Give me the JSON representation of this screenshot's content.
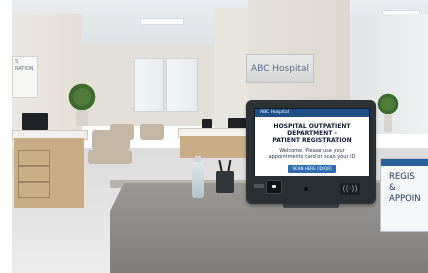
{
  "wall_sign": {
    "text": "ABC Hospital"
  },
  "left_sign": {
    "line1": "S",
    "line2": "RATION"
  },
  "kiosk": {
    "header_brand": "ABC Hospital",
    "title_line1": "HOSPITAL OUTPATIENT DEPARTMENT -",
    "title_line2": "PATIENT REGISTRATION",
    "message_line1": "Welcome. Please use your",
    "message_line2": "appointments card or scan your ID",
    "scan_button_label": "SCAN HERE [ID/QR]",
    "nfc_symbol": "((·))"
  },
  "counter_sign": {
    "line1": "REGIS",
    "line2": "&",
    "line3": "APPOIN"
  },
  "colors": {
    "screen_header": "#1f4f86",
    "scan_button": "#2f6db3",
    "desk_wood": "#c9ad84",
    "counter_stone": "#8c8a86"
  }
}
